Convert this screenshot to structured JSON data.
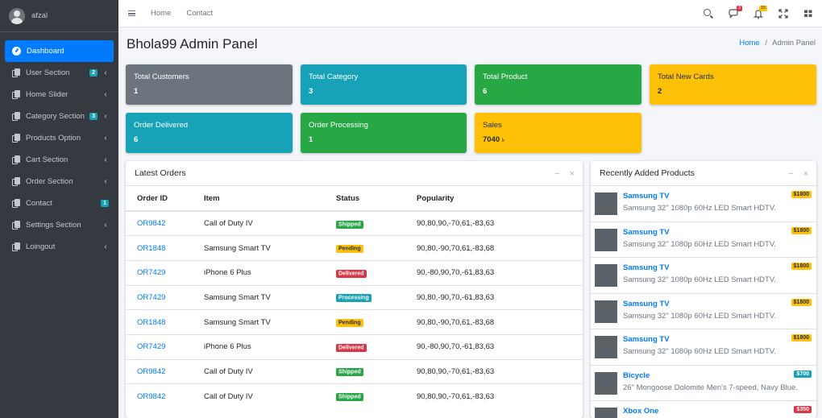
{
  "user": {
    "name": "afzal"
  },
  "sidebar": {
    "items": [
      {
        "label": "Dashboard",
        "badge": "",
        "chevron": false
      },
      {
        "label": "User Section",
        "badge": "2",
        "chevron": true
      },
      {
        "label": "Home Slider",
        "badge": "",
        "chevron": true
      },
      {
        "label": "Category Section",
        "badge": "3",
        "chevron": true
      },
      {
        "label": "Products Option",
        "badge": "",
        "chevron": true
      },
      {
        "label": "Cart Section",
        "badge": "",
        "chevron": true
      },
      {
        "label": "Order Section",
        "badge": "",
        "chevron": true
      },
      {
        "label": "Contact",
        "badge": "1",
        "chevron": false
      },
      {
        "label": "Settings Section",
        "badge": "",
        "chevron": true
      },
      {
        "label": "Loingout",
        "badge": "",
        "chevron": true
      }
    ]
  },
  "topbar": {
    "links": [
      "Home",
      "Contact"
    ],
    "messages_badge": "3",
    "notifications_badge": "15"
  },
  "page": {
    "title": "Bhola99 Admin Panel"
  },
  "breadcrumb": {
    "home": "Home",
    "separator": "/",
    "current": "Admin Panel"
  },
  "stats": [
    {
      "label": "Total Customers",
      "value": "1"
    },
    {
      "label": "Total Category",
      "value": "3"
    },
    {
      "label": "Total Product",
      "value": "6"
    },
    {
      "label": "Total New Cards",
      "value": "2"
    },
    {
      "label": "Order Delivered",
      "value": "6"
    },
    {
      "label": "Order Processing",
      "value": "1"
    },
    {
      "label": "Sales",
      "value": "7040",
      "unit": "৳"
    }
  ],
  "orders": {
    "title": "Latest Orders",
    "columns": [
      "Order ID",
      "Item",
      "Status",
      "Popularity"
    ],
    "rows": [
      {
        "id": "OR9842",
        "item": "Call of Duty IV",
        "status": "Shipped",
        "popularity": "90,80,90,-70,61,-83,63"
      },
      {
        "id": "OR1848",
        "item": "Samsung Smart TV",
        "status": "Pending",
        "popularity": "90,80,-90,70,61,-83,68"
      },
      {
        "id": "OR7429",
        "item": "iPhone 6 Plus",
        "status": "Delivered",
        "popularity": "90,-80,90,70,-61,83,63"
      },
      {
        "id": "OR7429",
        "item": "Samsung Smart TV",
        "status": "Processing",
        "popularity": "90,80,-90,70,-61,83,63"
      },
      {
        "id": "OR1848",
        "item": "Samsung Smart TV",
        "status": "Pending",
        "popularity": "90,80,-90,70,61,-83,68"
      },
      {
        "id": "OR7429",
        "item": "iPhone 6 Plus",
        "status": "Delivered",
        "popularity": "90,-80,90,70,-61,83,63"
      },
      {
        "id": "OR9842",
        "item": "Call of Duty IV",
        "status": "Shipped",
        "popularity": "90,80,90,-70,61,-83,63"
      },
      {
        "id": "OR9842",
        "item": "Call of Duty IV",
        "status": "Shipped",
        "popularity": "90,80,90,-70,61,-83,63"
      }
    ]
  },
  "products": {
    "title": "Recently Added Products",
    "items": [
      {
        "name": "Samsung TV",
        "desc": "Samsung 32\" 1080p 60Hz LED Smart HDTV.",
        "price": "$1800",
        "price_style": "warning"
      },
      {
        "name": "Samsung TV",
        "desc": "Samsung 32\" 1080p 60Hz LED Smart HDTV.",
        "price": "$1800",
        "price_style": "warning"
      },
      {
        "name": "Samsung TV",
        "desc": "Samsung 32\" 1080p 60Hz LED Smart HDTV.",
        "price": "$1800",
        "price_style": "warning"
      },
      {
        "name": "Samsung TV",
        "desc": "Samsung 32\" 1080p 60Hz LED Smart HDTV.",
        "price": "$1800",
        "price_style": "warning"
      },
      {
        "name": "Samsung TV",
        "desc": "Samsung 32\" 1080p 60Hz LED Smart HDTV.",
        "price": "$1800",
        "price_style": "warning"
      },
      {
        "name": "Bicycle",
        "desc": "26\" Mongoose Dolomite Men's 7-speed, Navy Blue.",
        "price": "$700",
        "price_style": "info"
      },
      {
        "name": "Xbox One",
        "desc": "",
        "price": "$350",
        "price_style": "danger"
      }
    ]
  },
  "colors": {
    "sidebar_bg": "#343a40",
    "primary": "#007bff",
    "info": "#17a2b8",
    "success": "#28a745",
    "warning": "#ffc107",
    "danger": "#dc3545",
    "secondary": "#6c757d"
  }
}
